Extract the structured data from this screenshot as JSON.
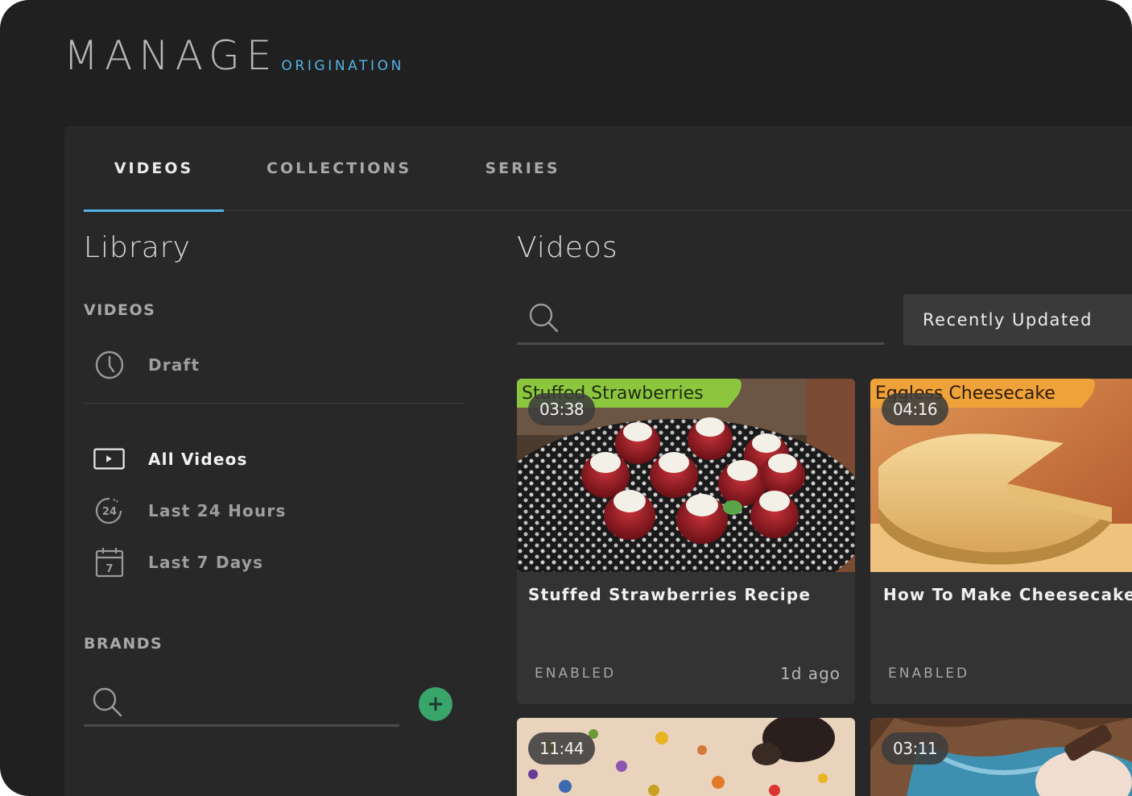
{
  "brand": {
    "main": "MANAGE",
    "sub": "ORIGINATION"
  },
  "tabs": [
    {
      "label": "VIDEOS",
      "active": true
    },
    {
      "label": "COLLECTIONS",
      "active": false
    },
    {
      "label": "SERIES",
      "active": false
    }
  ],
  "library": {
    "title": "Library",
    "videos_heading": "VIDEOS",
    "draft": {
      "label": "Draft",
      "icon": "clock-icon"
    },
    "items": [
      {
        "label": "All Videos",
        "icon": "play-icon",
        "active": true
      },
      {
        "label": "Last 24 Hours",
        "icon": "24-hours-icon",
        "active": false
      },
      {
        "label": "Last 7 Days",
        "icon": "calendar-7-icon",
        "active": false
      }
    ],
    "brands_heading": "BRANDS",
    "brands_search_placeholder": ""
  },
  "main": {
    "title": "Videos",
    "search_placeholder": "",
    "sort_label": "Recently Updated"
  },
  "videos": [
    {
      "title": "Stuffed Strawberries Recipe",
      "duration": "03:38",
      "status": "ENABLED",
      "updated": "1d ago",
      "banner": "Stuffed Strawberries"
    },
    {
      "title": "How To Make Cheesecake",
      "duration": "04:16",
      "status": "ENABLED",
      "updated": "",
      "banner": "Eggless Cheesecake"
    },
    {
      "title": "",
      "duration": "11:44",
      "status": "",
      "updated": "",
      "banner": ""
    },
    {
      "title": "",
      "duration": "03:11",
      "status": "",
      "updated": "",
      "banner": ""
    }
  ],
  "colors": {
    "accent": "#54b3e8",
    "background": "#202020",
    "panel": "#282828",
    "card": "#333333",
    "add_button": "#3aa56a",
    "banner_green": "#8cc63f",
    "banner_orange": "#f0a23a"
  }
}
